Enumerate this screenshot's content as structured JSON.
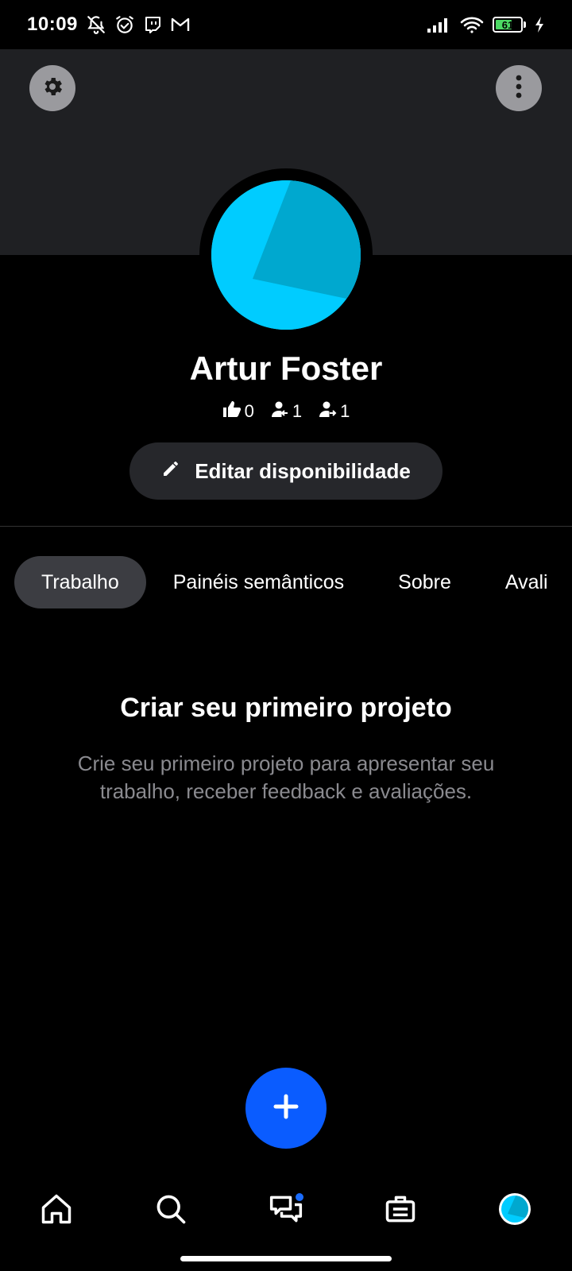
{
  "status_bar": {
    "time": "10:09",
    "battery_level": "61",
    "left_icons": [
      "bell-off-icon",
      "alarm-icon",
      "twitch-icon",
      "gmail-icon"
    ],
    "right_icons": [
      "signal-icon",
      "wifi-icon",
      "battery-icon",
      "charging-icon"
    ]
  },
  "header": {
    "settings_icon": "gear-icon",
    "menu_icon": "more-vertical-icon"
  },
  "profile": {
    "name": "Artur Foster",
    "stats": {
      "likes": "0",
      "followers": "1",
      "following": "1"
    }
  },
  "actions": {
    "edit_availability": "Editar disponibilidade"
  },
  "tabs": [
    {
      "label": "Trabalho",
      "active": true
    },
    {
      "label": "Painéis semânticos",
      "active": false
    },
    {
      "label": "Sobre",
      "active": false
    },
    {
      "label": "Avali",
      "active": false
    }
  ],
  "empty_state": {
    "title": "Criar seu primeiro projeto",
    "description": "Crie seu primeiro projeto para apresentar seu trabalho, receber feedback e avaliações."
  },
  "fab": {
    "icon": "plus-icon"
  },
  "bottom_nav": {
    "items": [
      "home-icon",
      "search-icon",
      "messages-icon",
      "briefcase-icon",
      "profile-avatar"
    ],
    "notification_dot_color": "#1a6cff"
  },
  "colors": {
    "accent": "#0a5cff",
    "avatar_primary": "#00ccff",
    "avatar_shade": "#00a8cf",
    "cover": "#1f2023",
    "muted_text": "#8a8a8f"
  }
}
